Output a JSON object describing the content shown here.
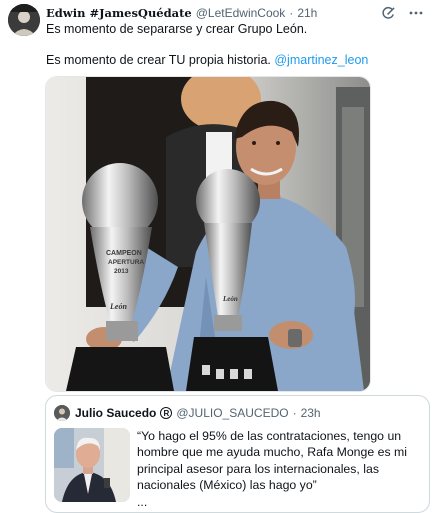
{
  "tweet": {
    "display_name": "Edwin #JamesQuédate",
    "handle": "@LetEdwinCook",
    "separator": "·",
    "time": "21h",
    "line1": "Es momento de separarse y crear Grupo León.",
    "line2": "Es momento de crear TU propia historia.",
    "mention": "@jmartinez_leon"
  },
  "photo": {
    "trophy_text_1": "CAMPEON",
    "trophy_text_2": "APERTURA",
    "trophy_text_3": "2013",
    "trophy_brand": "León"
  },
  "quote": {
    "display_name": "Julio Saucedo",
    "badge": "R",
    "handle": "@JULIO_SAUCEDO",
    "separator": "·",
    "time": "23h",
    "line1": "“Yo hago el 95% de las contrataciones, tengo un",
    "line2": "hombre que me ayuda mucho, Rafa Monge es mi",
    "line3": "principal asesor para los internacionales, las",
    "line4": "nacionales (México) las hago yo”",
    "line5": "..."
  },
  "colors": {
    "text": "#0f1419",
    "secondary": "#536471",
    "link": "#1d9bf0",
    "border": "#cfd9de"
  },
  "icons": [
    "grok-icon",
    "more-icon"
  ]
}
